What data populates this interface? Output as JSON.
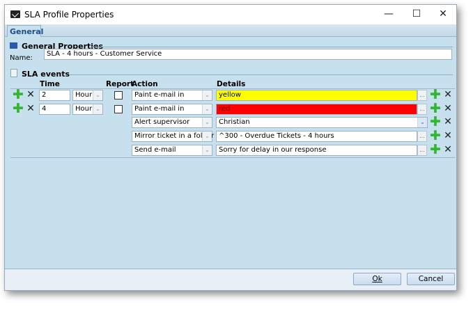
{
  "window": {
    "title": "SLA Profile Properties",
    "minimize": "—",
    "maximize": "☐",
    "close": "✕"
  },
  "tabs": [
    {
      "label": "General"
    }
  ],
  "general": {
    "header": "General Properties",
    "name_label": "Name:",
    "name_value": "SLA - 4 hours - Customer Service"
  },
  "sla": {
    "header": "SLA events",
    "columns": {
      "time": "Time",
      "report": "Report",
      "action": "Action",
      "details": "Details"
    },
    "events": [
      {
        "time": "2",
        "unit": "Hour",
        "actions": [
          {
            "action": "Paint e-mail in",
            "details": "yellow",
            "color": "#ffff00",
            "type": "dots"
          }
        ]
      },
      {
        "time": "4",
        "unit": "Hour",
        "actions": [
          {
            "action": "Paint e-mail in",
            "details": "red",
            "color": "#ff0000",
            "type": "dots"
          },
          {
            "action": "Alert supervisor",
            "details": "Christian",
            "color": "#ffffff",
            "type": "dropdown"
          },
          {
            "action": "Mirror ticket in a folder",
            "details": "^300 - Overdue Tickets - 4 hours",
            "color": "#ffffff",
            "type": "dots"
          },
          {
            "action": "Send e-mail",
            "details": "Sorry for delay in our response",
            "color": "#ffffff",
            "type": "dots"
          }
        ]
      }
    ]
  },
  "footer": {
    "ok": "Ok",
    "cancel": "Cancel"
  },
  "icons": {
    "dots": "...",
    "dropdown": "⌄",
    "plus": "✚",
    "remove": "✕"
  }
}
